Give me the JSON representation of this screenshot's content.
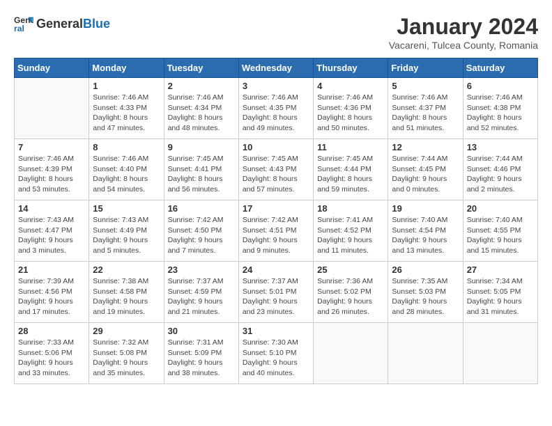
{
  "header": {
    "logo_general": "General",
    "logo_blue": "Blue",
    "month_year": "January 2024",
    "location": "Vacareni, Tulcea County, Romania"
  },
  "days_of_week": [
    "Sunday",
    "Monday",
    "Tuesday",
    "Wednesday",
    "Thursday",
    "Friday",
    "Saturday"
  ],
  "weeks": [
    [
      {
        "day": "",
        "info": ""
      },
      {
        "day": "1",
        "info": "Sunrise: 7:46 AM\nSunset: 4:33 PM\nDaylight: 8 hours\nand 47 minutes."
      },
      {
        "day": "2",
        "info": "Sunrise: 7:46 AM\nSunset: 4:34 PM\nDaylight: 8 hours\nand 48 minutes."
      },
      {
        "day": "3",
        "info": "Sunrise: 7:46 AM\nSunset: 4:35 PM\nDaylight: 8 hours\nand 49 minutes."
      },
      {
        "day": "4",
        "info": "Sunrise: 7:46 AM\nSunset: 4:36 PM\nDaylight: 8 hours\nand 50 minutes."
      },
      {
        "day": "5",
        "info": "Sunrise: 7:46 AM\nSunset: 4:37 PM\nDaylight: 8 hours\nand 51 minutes."
      },
      {
        "day": "6",
        "info": "Sunrise: 7:46 AM\nSunset: 4:38 PM\nDaylight: 8 hours\nand 52 minutes."
      }
    ],
    [
      {
        "day": "7",
        "info": "Sunrise: 7:46 AM\nSunset: 4:39 PM\nDaylight: 8 hours\nand 53 minutes."
      },
      {
        "day": "8",
        "info": "Sunrise: 7:46 AM\nSunset: 4:40 PM\nDaylight: 8 hours\nand 54 minutes."
      },
      {
        "day": "9",
        "info": "Sunrise: 7:45 AM\nSunset: 4:41 PM\nDaylight: 8 hours\nand 56 minutes."
      },
      {
        "day": "10",
        "info": "Sunrise: 7:45 AM\nSunset: 4:43 PM\nDaylight: 8 hours\nand 57 minutes."
      },
      {
        "day": "11",
        "info": "Sunrise: 7:45 AM\nSunset: 4:44 PM\nDaylight: 8 hours\nand 59 minutes."
      },
      {
        "day": "12",
        "info": "Sunrise: 7:44 AM\nSunset: 4:45 PM\nDaylight: 9 hours\nand 0 minutes."
      },
      {
        "day": "13",
        "info": "Sunrise: 7:44 AM\nSunset: 4:46 PM\nDaylight: 9 hours\nand 2 minutes."
      }
    ],
    [
      {
        "day": "14",
        "info": "Sunrise: 7:43 AM\nSunset: 4:47 PM\nDaylight: 9 hours\nand 3 minutes."
      },
      {
        "day": "15",
        "info": "Sunrise: 7:43 AM\nSunset: 4:49 PM\nDaylight: 9 hours\nand 5 minutes."
      },
      {
        "day": "16",
        "info": "Sunrise: 7:42 AM\nSunset: 4:50 PM\nDaylight: 9 hours\nand 7 minutes."
      },
      {
        "day": "17",
        "info": "Sunrise: 7:42 AM\nSunset: 4:51 PM\nDaylight: 9 hours\nand 9 minutes."
      },
      {
        "day": "18",
        "info": "Sunrise: 7:41 AM\nSunset: 4:52 PM\nDaylight: 9 hours\nand 11 minutes."
      },
      {
        "day": "19",
        "info": "Sunrise: 7:40 AM\nSunset: 4:54 PM\nDaylight: 9 hours\nand 13 minutes."
      },
      {
        "day": "20",
        "info": "Sunrise: 7:40 AM\nSunset: 4:55 PM\nDaylight: 9 hours\nand 15 minutes."
      }
    ],
    [
      {
        "day": "21",
        "info": "Sunrise: 7:39 AM\nSunset: 4:56 PM\nDaylight: 9 hours\nand 17 minutes."
      },
      {
        "day": "22",
        "info": "Sunrise: 7:38 AM\nSunset: 4:58 PM\nDaylight: 9 hours\nand 19 minutes."
      },
      {
        "day": "23",
        "info": "Sunrise: 7:37 AM\nSunset: 4:59 PM\nDaylight: 9 hours\nand 21 minutes."
      },
      {
        "day": "24",
        "info": "Sunrise: 7:37 AM\nSunset: 5:01 PM\nDaylight: 9 hours\nand 23 minutes."
      },
      {
        "day": "25",
        "info": "Sunrise: 7:36 AM\nSunset: 5:02 PM\nDaylight: 9 hours\nand 26 minutes."
      },
      {
        "day": "26",
        "info": "Sunrise: 7:35 AM\nSunset: 5:03 PM\nDaylight: 9 hours\nand 28 minutes."
      },
      {
        "day": "27",
        "info": "Sunrise: 7:34 AM\nSunset: 5:05 PM\nDaylight: 9 hours\nand 31 minutes."
      }
    ],
    [
      {
        "day": "28",
        "info": "Sunrise: 7:33 AM\nSunset: 5:06 PM\nDaylight: 9 hours\nand 33 minutes."
      },
      {
        "day": "29",
        "info": "Sunrise: 7:32 AM\nSunset: 5:08 PM\nDaylight: 9 hours\nand 35 minutes."
      },
      {
        "day": "30",
        "info": "Sunrise: 7:31 AM\nSunset: 5:09 PM\nDaylight: 9 hours\nand 38 minutes."
      },
      {
        "day": "31",
        "info": "Sunrise: 7:30 AM\nSunset: 5:10 PM\nDaylight: 9 hours\nand 40 minutes."
      },
      {
        "day": "",
        "info": ""
      },
      {
        "day": "",
        "info": ""
      },
      {
        "day": "",
        "info": ""
      }
    ]
  ]
}
